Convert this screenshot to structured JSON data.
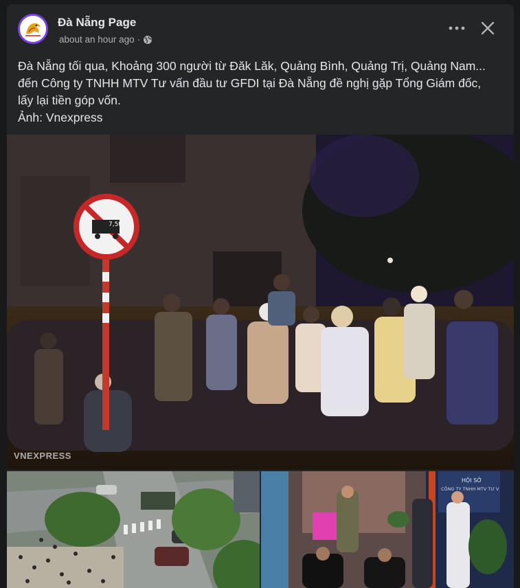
{
  "page": {
    "name": "Đà Nẵng Page",
    "time": "about an hour ago",
    "separator": "·",
    "privacy_icon": "globe-icon",
    "avatar_label": "Đà Nẵng"
  },
  "actions": {
    "more_icon": "more-horizontal-icon",
    "close_icon": "close-icon"
  },
  "post": {
    "text": "Đà Nẵng tối qua, Khoảng 300 người từ Đăk Lăk, Quảng Bình, Quảng Trị, Quảng Nam... đến Công ty TNHH MTV Tư vấn đầu tư GFDI tại Đà Nẵng đề nghị gặp Tổng Giám đốc, lấy lại tiền góp vốn.\nẢnh: Vnexpress"
  },
  "photos": {
    "main": {
      "watermark": "VNEXPRESS",
      "sign_text": "7,5t"
    },
    "bottom_right": {
      "sign_text": "HỘI SỞ",
      "sign_text_2": "CÔNG TY TNHH MTV TƯ V"
    }
  },
  "colors": {
    "background": "#18191a",
    "card": "#242526",
    "text_primary": "#e4e6eb",
    "text_secondary": "#b0b3b8",
    "avatar_ring": "#7b3fe4"
  }
}
